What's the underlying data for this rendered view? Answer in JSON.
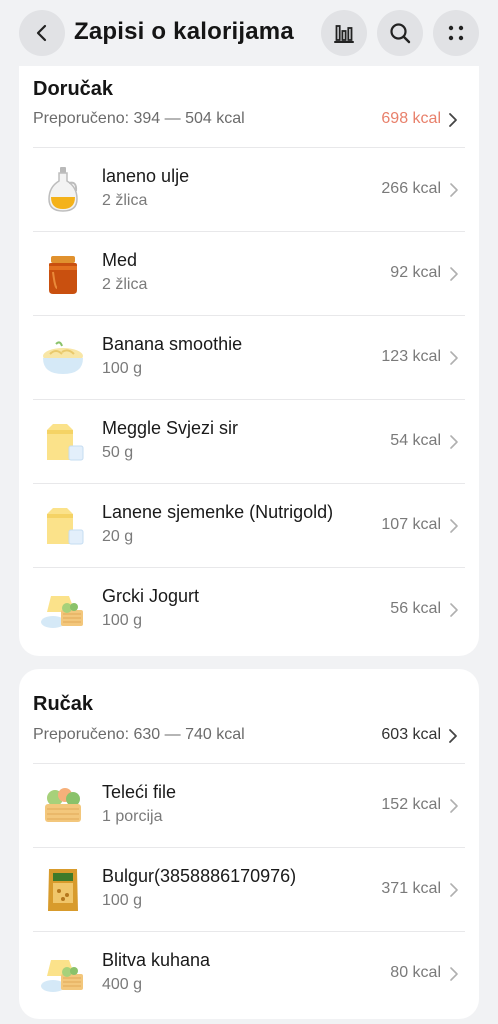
{
  "header": {
    "title": "Zapisi o kalorijama",
    "icons": [
      "back-arrow-icon",
      "bar-chart-icon",
      "search-icon",
      "more-dots-icon"
    ]
  },
  "colors": {
    "over_limit": "#e8806b",
    "background": "#f1f2f4",
    "card": "#ffffff"
  },
  "meals": [
    {
      "title": "Doručak",
      "recommended": "Preporučeno: 394 — 504 kcal",
      "total": "698 kcal",
      "total_over": true,
      "items": [
        {
          "name": "laneno ulje",
          "amount": "2 žlica",
          "kcal": "266 kcal",
          "icon": "oil-bottle-icon"
        },
        {
          "name": "Med",
          "amount": "2 žlica",
          "kcal": "92 kcal",
          "icon": "honey-jar-icon"
        },
        {
          "name": "Banana smoothie",
          "amount": "100 g",
          "kcal": "123 kcal",
          "icon": "bowl-icon"
        },
        {
          "name": "Meggle Svjezi sir",
          "amount": "50 g",
          "kcal": "54 kcal",
          "icon": "dairy-package-icon"
        },
        {
          "name": "Lanene sjemenke (Nutrigold)",
          "amount": "20 g",
          "kcal": "107 kcal",
          "icon": "dairy-package-icon"
        },
        {
          "name": "Grcki Jogurt",
          "amount": "100 g",
          "kcal": "56 kcal",
          "icon": "food-basket-icon"
        }
      ]
    },
    {
      "title": "Ručak",
      "recommended": "Preporučeno: 630 — 740 kcal",
      "total": "603 kcal",
      "total_over": false,
      "items": [
        {
          "name": "Teleći file",
          "amount": "1 porcija",
          "kcal": "152 kcal",
          "icon": "veggie-basket-icon"
        },
        {
          "name": "Bulgur(3858886170976)",
          "amount": "100 g",
          "kcal": "371 kcal",
          "icon": "grain-bag-icon"
        },
        {
          "name": "Blitva kuhana",
          "amount": "400 g",
          "kcal": "80 kcal",
          "icon": "food-basket-icon"
        }
      ]
    }
  ]
}
